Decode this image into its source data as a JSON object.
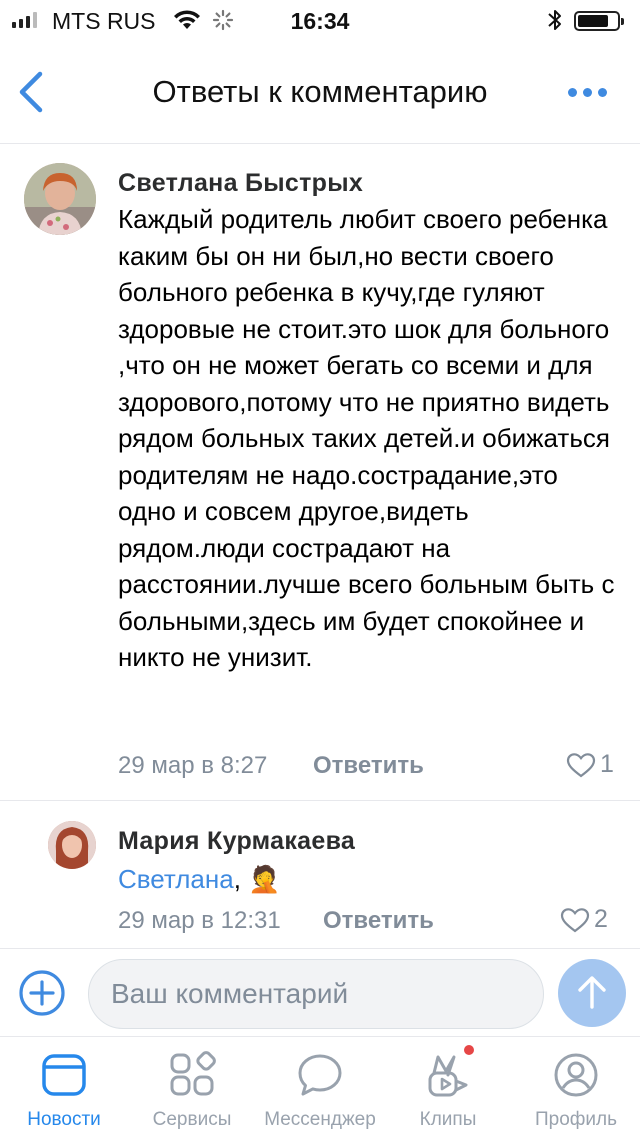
{
  "status_bar": {
    "carrier": "MTS RUS",
    "time": "16:34"
  },
  "header": {
    "title": "Ответы к комментарию",
    "back_icon": "chevron-left-icon",
    "more_icon": "more-horizontal-icon"
  },
  "comments": [
    {
      "author": "Светлана Быстрых",
      "text": "Каждый родитель любит своего ребенка каким бы он ни был,но вести своего больного ребенка в кучу,где гуляют здоровые не стоит.это шок для больного ,что он не может бегать со всеми и для здорового,потому что не приятно видеть рядом больных таких детей.и обижаться родителям не надо.сострадание,это одно и совсем другое,видеть рядом.люди сострадают на расстоянии.лучше всего больным быть с больными,здесь им будет спокойнее и никто не унизит.",
      "date": "29 мар в 8:27",
      "reply_label": "Ответить",
      "likes": "1"
    },
    {
      "author": "Мария Курмакаева",
      "mention": "Светлана",
      "text_suffix": ",",
      "emoji": "🤦",
      "date": "29 мар в 12:31",
      "reply_label": "Ответить",
      "likes": "2"
    }
  ],
  "input": {
    "placeholder": "Ваш комментарий",
    "add_icon": "plus-circle-icon",
    "emoji_icon": "smile-icon",
    "send_icon": "arrow-up-icon"
  },
  "tabs": [
    {
      "label": "Новости",
      "icon": "news-icon",
      "active": true
    },
    {
      "label": "Сервисы",
      "icon": "services-icon",
      "active": false
    },
    {
      "label": "Мессенджер",
      "icon": "messenger-icon",
      "active": false
    },
    {
      "label": "Клипы",
      "icon": "clips-icon",
      "active": false,
      "badge": true
    },
    {
      "label": "Профиль",
      "icon": "profile-icon",
      "active": false
    }
  ],
  "colors": {
    "accent": "#3f8ae0",
    "active_tab": "#2688eb",
    "secondary_text": "#818c99",
    "send_button": "#a4c6f0",
    "badge": "#e64646"
  }
}
